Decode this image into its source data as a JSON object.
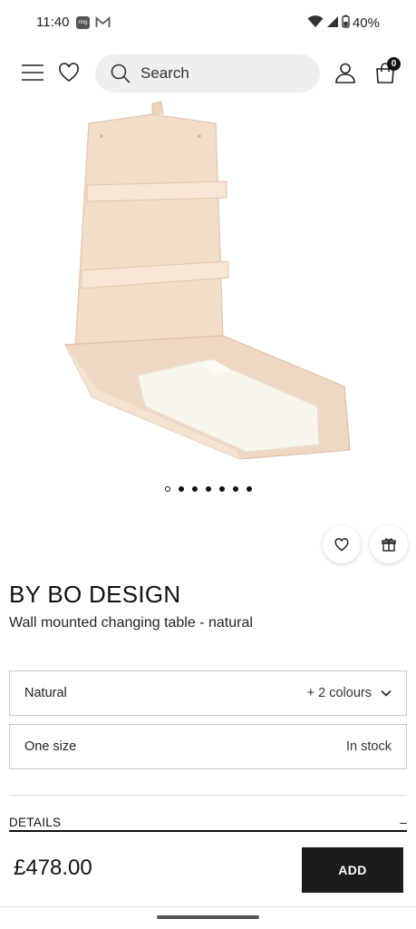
{
  "status_bar": {
    "time": "11:40",
    "ring_label": "ring",
    "battery": "40%"
  },
  "header": {
    "search_placeholder": "Search",
    "bag_count": "0"
  },
  "carousel": {
    "count": 7,
    "active_index": 0
  },
  "product": {
    "brand": "BY BO DESIGN",
    "title": "Wall mounted changing table - natural",
    "colour_selected": "Natural",
    "colour_more": "+ 2 colours",
    "size": "One size",
    "stock": "In stock",
    "details_label": "DETAILS",
    "details_toggle": "–",
    "price": "£478.00",
    "add_label": "ADD"
  },
  "colors": {
    "accent": "#1c1c1c",
    "wood": "#f3e1cf",
    "cushion": "#f7f4ea"
  },
  "icons": [
    "menu-icon",
    "heart-icon",
    "search-icon",
    "account-icon",
    "bag-icon",
    "gift-icon",
    "chevron-down-icon"
  ]
}
